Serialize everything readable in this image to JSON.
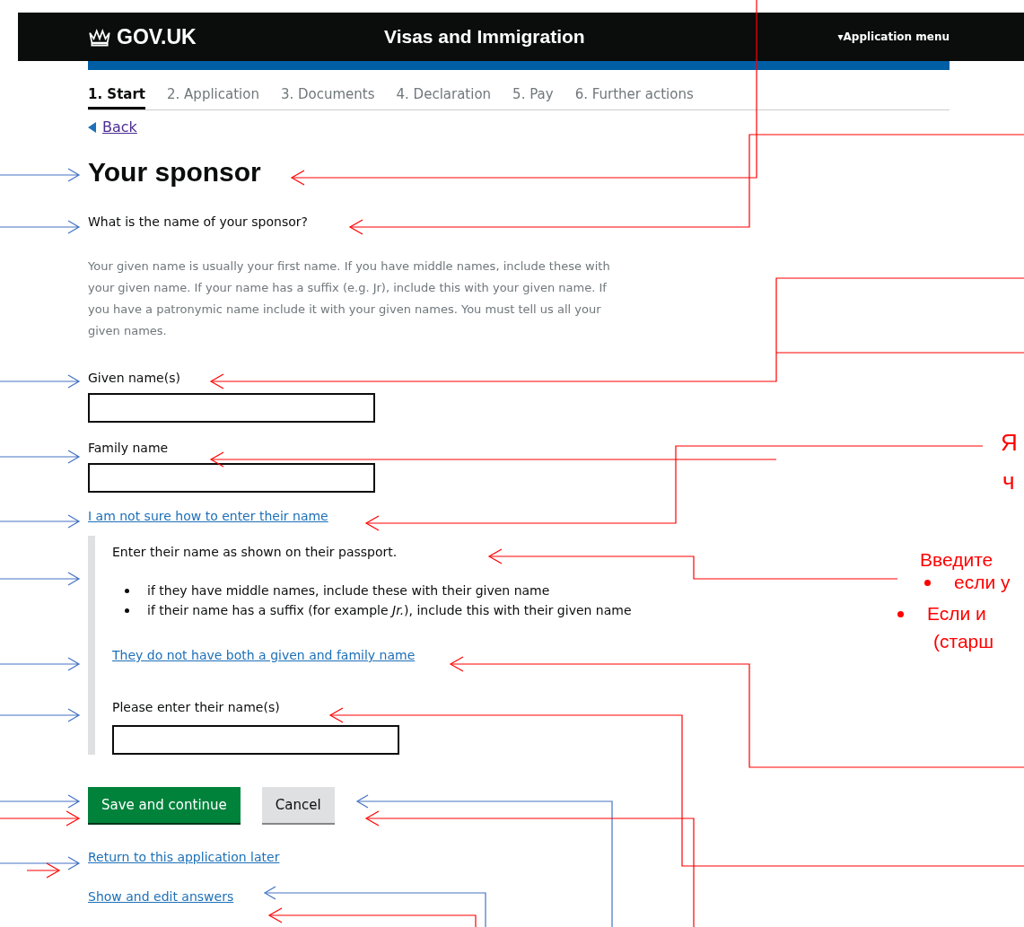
{
  "header": {
    "logo": "GOV.UK",
    "service": "Visas and Immigration",
    "menu": "▾Application menu"
  },
  "steps": [
    {
      "label": "1. Start",
      "selected": true
    },
    {
      "label": "2. Application",
      "selected": false
    },
    {
      "label": "3. Documents",
      "selected": false
    },
    {
      "label": "4. Declaration",
      "selected": false
    },
    {
      "label": "5. Pay",
      "selected": false
    },
    {
      "label": "6. Further actions",
      "selected": false
    }
  ],
  "back": "Back",
  "title": "Your sponsor",
  "question": "What is the name of your sponsor?",
  "hint": "Your given name is usually your first name. If you have middle names, include these with your given name. If your name has a suffix (e.g. Jr), include this with your given name. If you have a patronymic name include it with your given names. You must tell us all your given names.",
  "fields": [
    {
      "label": "Given name(s)"
    },
    {
      "label": "Family name"
    }
  ],
  "help_link": "I am not sure how to enter their name",
  "details": {
    "intro": "Enter their name as shown on their passport.",
    "bullets": [
      "if they have middle names, include these with their given name",
      "if their name has a suffix (for example *Jr.*), include this with their given name"
    ],
    "link": "They do not have both a given and family name",
    "field_label": "Please enter their name(s)"
  },
  "buttons": [
    {
      "label": "Save and continue",
      "kind": "primary"
    },
    {
      "label": "Cancel",
      "kind": "secondary"
    }
  ],
  "footer_links": [
    "Return to this application later",
    "Show and edit answers"
  ],
  "annotations": [
    {
      "text": "Я",
      "kind": "large"
    },
    {
      "text": "ч",
      "kind": "large"
    },
    {
      "text": "Введите",
      "kind": "plain"
    },
    {
      "text": "если у",
      "kind": "bullet"
    },
    {
      "text": "Если и",
      "kind": "bullet"
    },
    {
      "text": "(старш",
      "kind": "plain"
    }
  ]
}
